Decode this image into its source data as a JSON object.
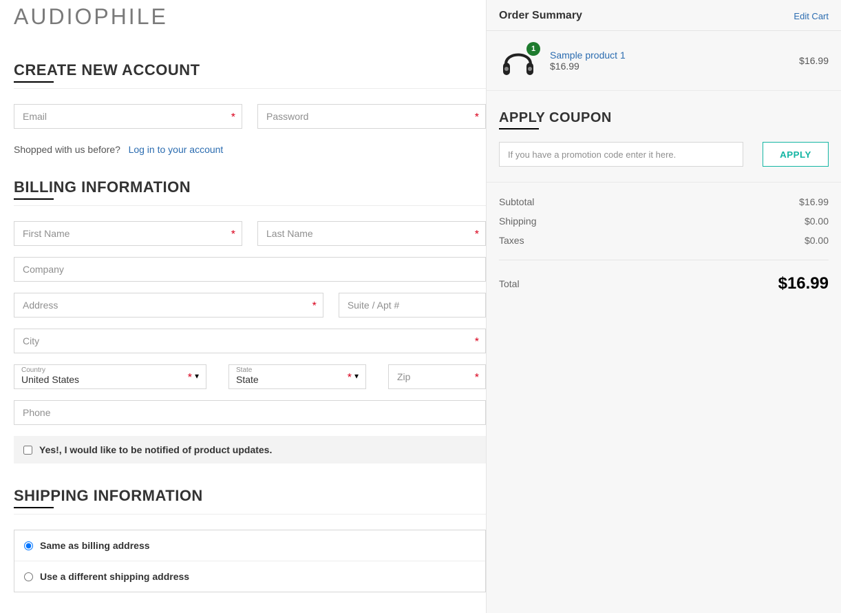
{
  "logo": "AUDIOPHILE",
  "account": {
    "title": "CREATE NEW ACCOUNT",
    "email_ph": "Email",
    "password_ph": "Password",
    "shopped_before": "Shopped with us before?",
    "login_link": "Log in to your account"
  },
  "billing": {
    "title": "BILLING INFORMATION",
    "first_name_ph": "First Name",
    "last_name_ph": "Last Name",
    "company_ph": "Company",
    "address_ph": "Address",
    "suite_ph": "Suite / Apt #",
    "city_ph": "City",
    "country_label": "Country",
    "country_value": "United States",
    "state_label": "State",
    "state_value": "State",
    "zip_ph": "Zip",
    "phone_ph": "Phone",
    "notify_label": "Yes!, I would like to be notified of product updates."
  },
  "shipping": {
    "title": "SHIPPING INFORMATION",
    "same_label": "Same as billing address",
    "diff_label": "Use a different shipping address"
  },
  "summary": {
    "header": "Order Summary",
    "edit": "Edit Cart",
    "item": {
      "name": "Sample product 1",
      "price": "$16.99",
      "qty": "1",
      "line_total": "$16.99"
    },
    "coupon_title": "APPLY COUPON",
    "coupon_ph": "If you have a promotion code enter it here.",
    "apply_btn": "APPLY",
    "subtotal_label": "Subtotal",
    "subtotal_value": "$16.99",
    "shipping_label": "Shipping",
    "shipping_value": "$0.00",
    "taxes_label": "Taxes",
    "taxes_value": "$0.00",
    "total_label": "Total",
    "total_value": "$16.99"
  }
}
